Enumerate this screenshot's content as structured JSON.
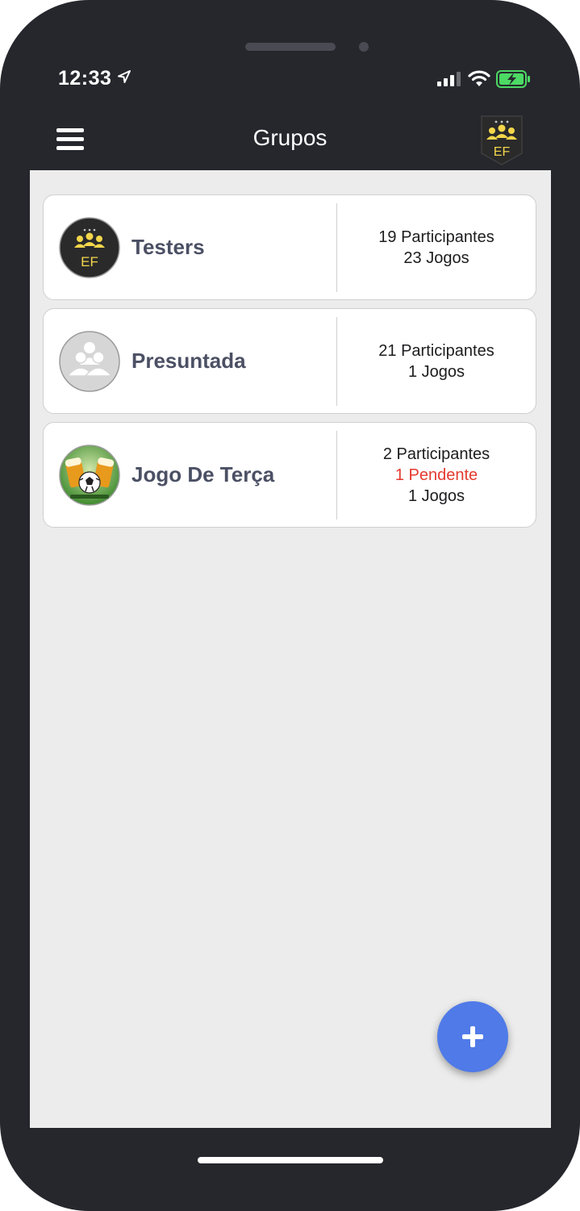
{
  "status_bar": {
    "time": "12:33"
  },
  "header": {
    "title": "Grupos",
    "logo_text": "EF"
  },
  "groups": [
    {
      "name": "Testers",
      "participants": "19 Participantes",
      "pending": "",
      "games": "23 Jogos",
      "avatar": "ef-logo"
    },
    {
      "name": "Presuntada",
      "participants": "21 Participantes",
      "pending": "",
      "games": "1 Jogos",
      "avatar": "group-placeholder"
    },
    {
      "name": "Jogo De Terça",
      "participants": "2 Participantes",
      "pending": "1 Pendente",
      "games": "1 Jogos",
      "avatar": "beer-soccer-photo"
    }
  ],
  "colors": {
    "accent": "#4f7ae8",
    "pending": "#e43a2f",
    "dark": "#26272d",
    "gold": "#f3d64b"
  },
  "fab": {
    "icon": "plus-icon"
  }
}
